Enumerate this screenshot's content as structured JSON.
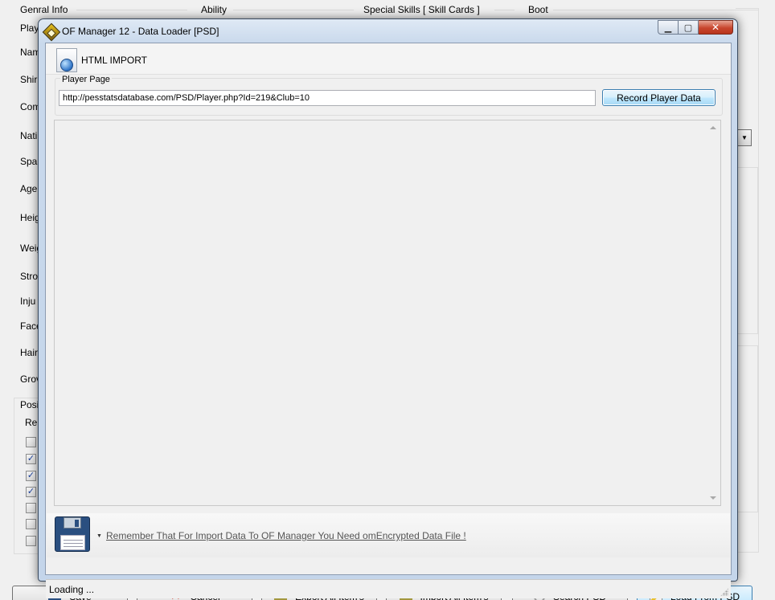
{
  "background": {
    "group_headers": [
      "Genral Info",
      "Ability",
      "Special Skills [ Skill Cards ]",
      "Boot"
    ],
    "left_labels": [
      "Play",
      "Nam",
      "Shir",
      "Com",
      "Nati",
      "Spa",
      "Age",
      "Heig",
      "Weig",
      "Stro",
      "Inju",
      "Face",
      "Hair",
      "Grov"
    ],
    "position_group_header": "Posi",
    "position_sub_label": "Re",
    "checkboxes": [
      false,
      true,
      true,
      true,
      false,
      false,
      false
    ],
    "bottom_buttons": [
      {
        "label": "Save"
      },
      {
        "label": "Cancel"
      },
      {
        "label": "Export All Item's"
      },
      {
        "label": "Import All Item's"
      },
      {
        "label": "Search PSD"
      },
      {
        "label": "Load From PSD"
      }
    ]
  },
  "dialog": {
    "title": "OF Manager 12 - Data Loader [PSD]",
    "header_title": "HTML IMPORT",
    "player_page": {
      "group_label": "Player Page",
      "url_value": "http://pesstatsdatabase.com/PSD/Player.php?Id=219&Club=10",
      "record_button": "Record Player Data"
    },
    "notice_text": "Remember That For Import Data To OF Manager You Need omEncrypted Data File !",
    "status_text": "Loading ..."
  }
}
